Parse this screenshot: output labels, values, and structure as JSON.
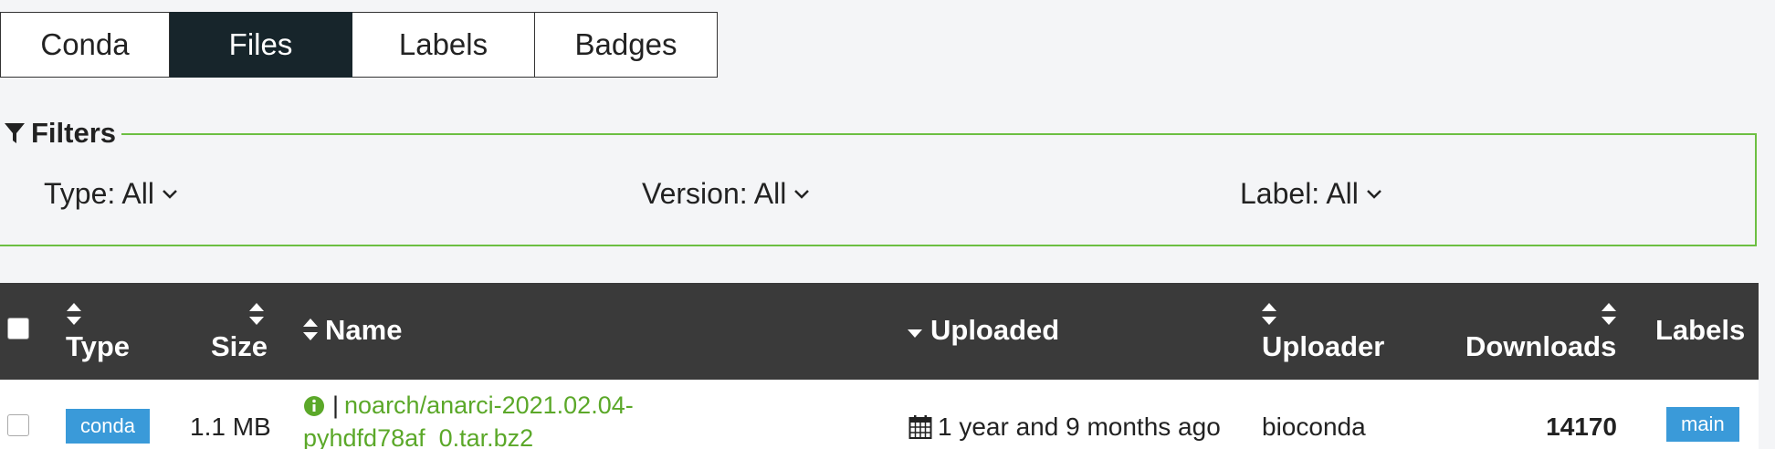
{
  "tabs": [
    {
      "label": "Conda",
      "active": false
    },
    {
      "label": "Files",
      "active": true
    },
    {
      "label": "Labels",
      "active": false
    },
    {
      "label": "Badges",
      "active": false
    }
  ],
  "filters": {
    "title": "Filters",
    "type": "Type: All",
    "version": "Version: All",
    "label": "Label: All"
  },
  "table": {
    "columns": {
      "type": "Type",
      "size": "Size",
      "name": "Name",
      "uploaded": "Uploaded",
      "uploader": "Uploader",
      "downloads": "Downloads",
      "labels": "Labels"
    },
    "rows": [
      {
        "type": "conda",
        "size": "1.1 MB",
        "name_line1": "noarch/anarci-2021.02.04-",
        "name_line2": "pyhdfd78af_0.tar.bz2",
        "uploaded": "1 year and 9 months ago",
        "uploader": "bioconda",
        "downloads": "14170",
        "label": "main"
      }
    ]
  },
  "colors": {
    "active_tab": "#17252b",
    "filter_border": "#6cbf42",
    "link_green": "#5ba829",
    "badge_blue": "#3a9ad9",
    "header_bg": "#3a3a3a"
  }
}
